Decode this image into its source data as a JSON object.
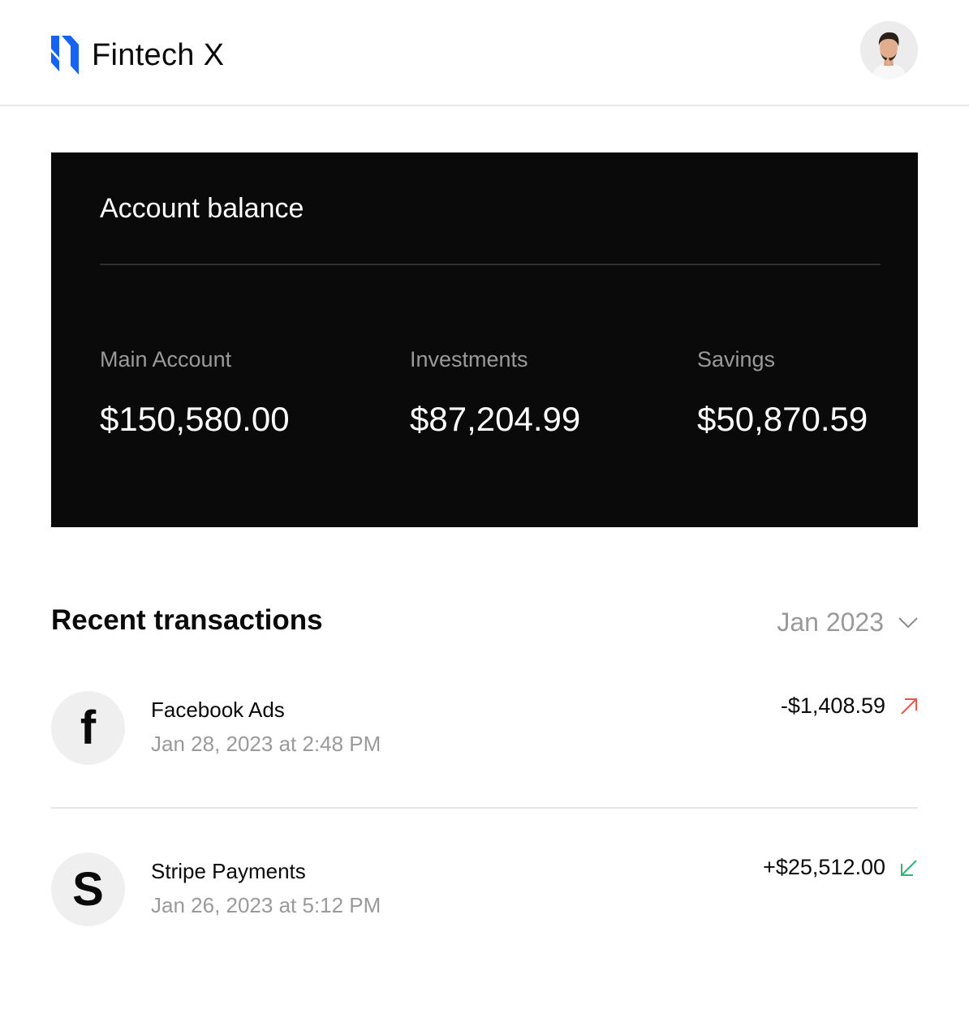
{
  "app": {
    "name": "Fintech X",
    "logo_icon": "fintech-x-logo-icon",
    "brand_color": "#1463f3",
    "avatar_icon": "user-avatar"
  },
  "balance": {
    "title": "Account balance",
    "accounts": [
      {
        "label": "Main Account",
        "value": "$150,580.00"
      },
      {
        "label": "Investments",
        "value": "$87,204.99"
      },
      {
        "label": "Savings",
        "value": "$50,870.59"
      }
    ]
  },
  "transactions": {
    "title": "Recent transactions",
    "period": "Jan 2023",
    "period_icon": "chevron-down-icon",
    "items": [
      {
        "name": "Facebook Ads",
        "date": "Jan 28, 2023 at 2:48 PM",
        "amount": "-$1,408.59",
        "icon": "facebook-icon",
        "icon_glyph": "f",
        "direction_icon": "arrow-up-right-icon",
        "direction_color": "#f0554a"
      },
      {
        "name": "Stripe Payments",
        "date": "Jan 26, 2023 at 5:12 PM",
        "amount": "+$25,512.00",
        "icon": "stripe-icon",
        "icon_glyph": "S",
        "direction_icon": "arrow-down-left-icon",
        "direction_color": "#2bb673"
      }
    ]
  }
}
